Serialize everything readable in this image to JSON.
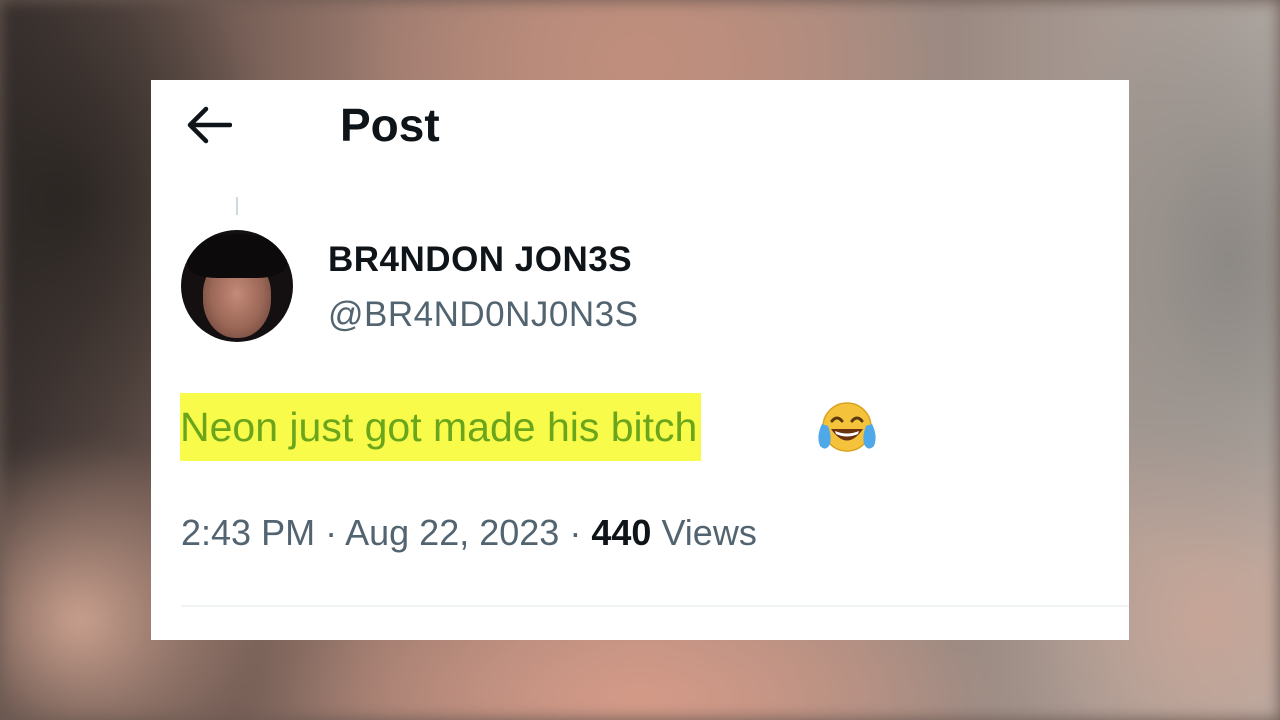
{
  "header": {
    "back_icon": "arrow-left-icon",
    "title": "Post"
  },
  "author": {
    "display_name": "BR4NDON JON3S",
    "handle": "@BR4ND0NJ0N3S"
  },
  "tweet": {
    "text": "Neon just got made his bitch",
    "emoji": "face-with-tears-of-joy-icon",
    "highlight_color": "#f8fb4a",
    "text_color": "#6aa51c"
  },
  "meta": {
    "time": "2:43 PM",
    "separator": "·",
    "date": "Aug 22, 2023",
    "views_count": "440",
    "views_label": "Views"
  }
}
